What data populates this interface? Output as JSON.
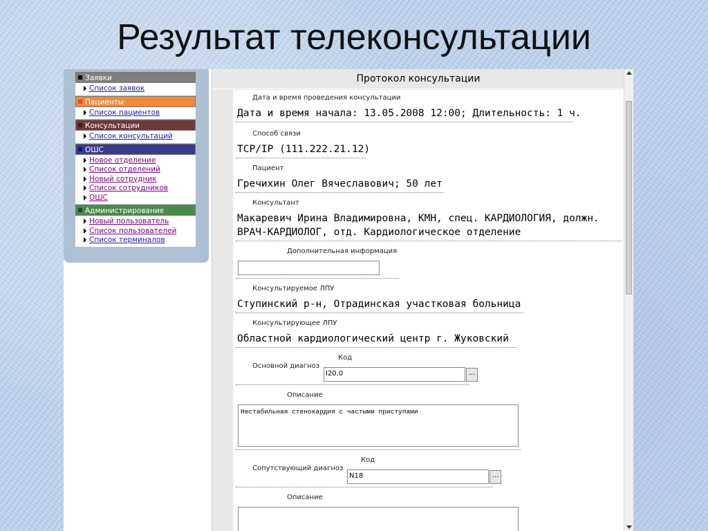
{
  "slide": {
    "title": "Результат телеконсультации"
  },
  "sidebar": {
    "sections": [
      {
        "title": "Заявки",
        "color": "#7f7f7f",
        "square": "#000000",
        "links": [
          "Список заявок"
        ]
      },
      {
        "title": "Пациенты",
        "color": "#f28a3c",
        "square": "#e0501a",
        "links": [
          "Список пациентов"
        ]
      },
      {
        "title": "Консультации",
        "color": "#6b3a3a",
        "square": "#3a1a1a",
        "links": [
          "Список консультаций"
        ]
      },
      {
        "title": "ОШС",
        "color": "#3b3b8e",
        "square": "#1a1a5a",
        "links": [
          "Новое отделение",
          "Список отделений",
          "Новый сотрудник",
          "Список сотрудников",
          "ОШС"
        ]
      },
      {
        "title": "Администрирование",
        "color": "#4a8a4a",
        "square": "#1e4a1e",
        "links": [
          "Новый пользователь",
          "Список пользователей",
          "Список терминалов"
        ]
      }
    ]
  },
  "content": {
    "header": "Протокол консультации",
    "fields": {
      "datetime_label": "Дата и время проведения консультации",
      "datetime_value": "Дата и время начала: 13.05.2008 12:00; Длительность: 1 ч.",
      "connection_label": "Способ связи",
      "connection_value": "TCP/IP (111.222.21.12)",
      "patient_label": "Пациент",
      "patient_value": "Гречихин Олег Вячеславович; 50 лет",
      "consultant_label": "Консультант",
      "consultant_value_1": "Макаревич Ирина Владимировна, КМН, спец. КАРДИОЛОГИЯ, должн.",
      "consultant_value_2": "ВРАЧ-КАРДИОЛОГ, отд. Кардиологическое отделение",
      "additional_label": "Дополнительная информация",
      "additional_value": "",
      "consulted_lpu_label": "Консультируемое ЛПУ",
      "consulted_lpu_value": "Ступинский р-н, Отрадинская участковая больница",
      "consulting_lpu_label": "Консультирующее ЛПУ",
      "consulting_lpu_value": "Областной кардиологический центр г. Жуковский",
      "main_diag_label": "Основной диагноз",
      "main_code_label": "Код",
      "main_code_value": "I20.0",
      "main_desc_label": "Описание",
      "main_desc_value": "Нестабильная стенокардия с частыми приступами",
      "accomp_diag_label": "Сопутствующий диагноз",
      "accomp_code_label": "Код",
      "accomp_code_value": "N18",
      "accomp_desc_label": "Описание",
      "accomp_desc_value": "",
      "pick_button": "..."
    }
  }
}
